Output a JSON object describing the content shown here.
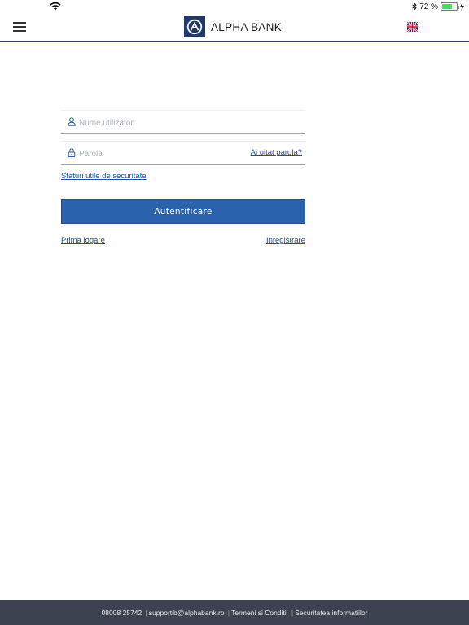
{
  "status_bar": {
    "battery_text": "72 %",
    "battery_level": 0.72,
    "battery_color": "#4cd964"
  },
  "header": {
    "brand": "ALPHA BANK",
    "brand_color": "#1f3a68",
    "menu_icon": "hamburger-menu-icon",
    "language_icon": "uk-flag-icon"
  },
  "login_form": {
    "username_placeholder": "Nume utilizator",
    "username_value": "",
    "password_placeholder": "Parola",
    "password_value": "",
    "forgot_password": "Ai uitat parola?",
    "security_tips": "Sfaturi utile de securitate",
    "submit_label": "Autentificare",
    "submit_color": "#2b62ad",
    "first_login": "Prima logare",
    "register": "Inregistrare"
  },
  "footer": {
    "phone": "08008 25742",
    "email": "supportib@alphabank.ro",
    "terms": "Termeni si Conditii",
    "security_info": "Securitatea informatiilor",
    "background": "#3d4251"
  }
}
